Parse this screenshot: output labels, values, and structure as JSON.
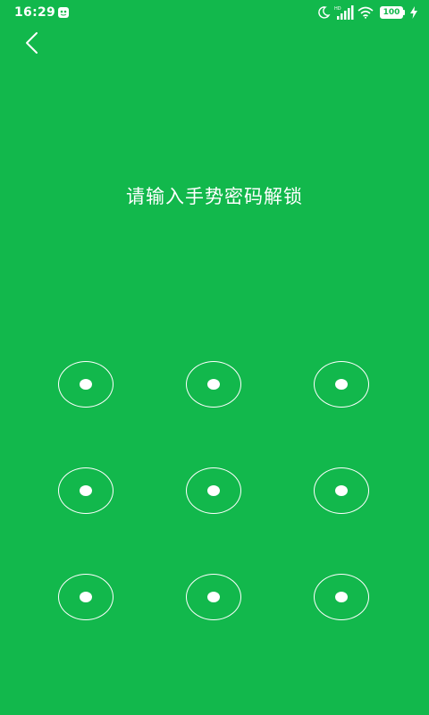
{
  "status_bar": {
    "time": "16:29",
    "battery_level": "100",
    "icons": [
      "app-notification-icon",
      "moon-icon",
      "hd-signal-icon",
      "wifi-icon",
      "battery-icon",
      "charging-icon"
    ]
  },
  "header": {
    "back_icon": "chevron-left-icon"
  },
  "prompt": {
    "text": "请输入手势密码解锁"
  },
  "pattern": {
    "nodes": [
      1,
      2,
      3,
      4,
      5,
      6,
      7,
      8,
      9
    ]
  },
  "colors": {
    "background": "#12B84C",
    "foreground": "#FFFFFF"
  }
}
